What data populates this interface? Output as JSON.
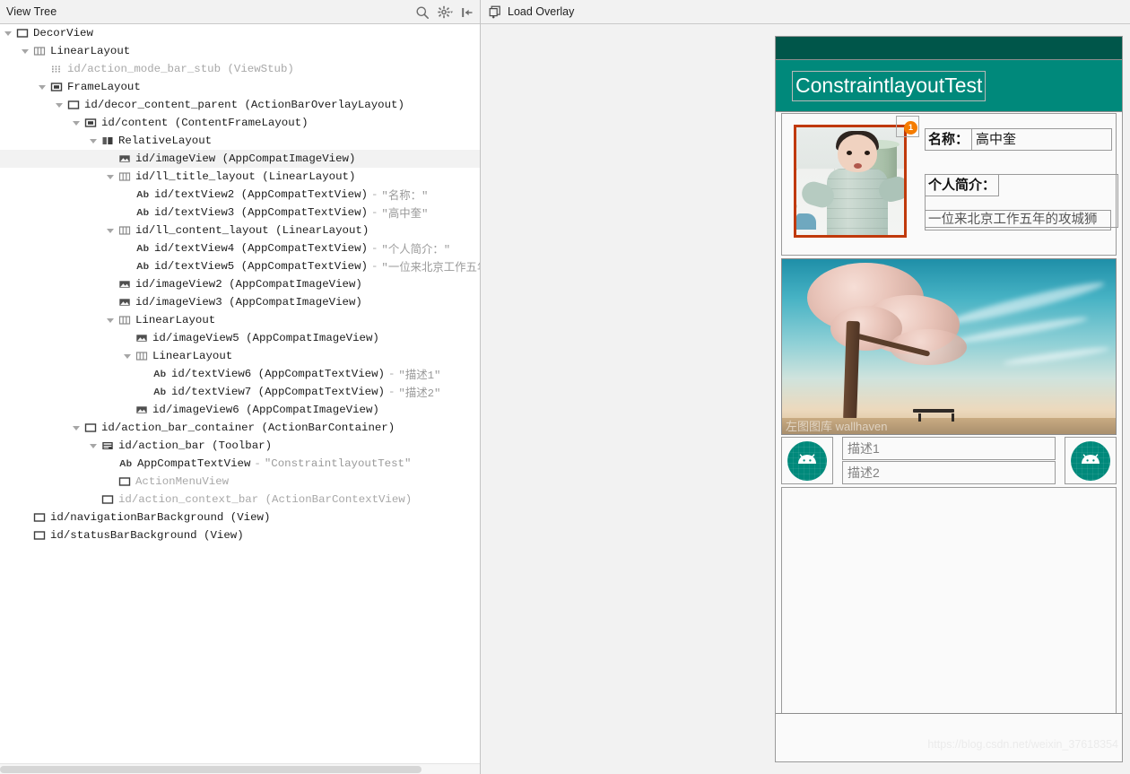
{
  "tree_panel": {
    "title": "View Tree",
    "header_icons": [
      {
        "name": "search-icon",
        "label": "Search"
      },
      {
        "name": "gear-dropdown-icon",
        "label": "Settings"
      },
      {
        "name": "collapse-panel-icon",
        "label": "Collapse"
      }
    ],
    "nodes": [
      {
        "depth": 0,
        "twisty": true,
        "icon": "framelayout-icon",
        "label": "DecorView",
        "type": "",
        "value": "",
        "dim": false,
        "selected": false
      },
      {
        "depth": 1,
        "twisty": true,
        "icon": "linearlayout-icon",
        "label": "LinearLayout",
        "type": "",
        "value": "",
        "dim": false,
        "selected": false
      },
      {
        "depth": 2,
        "twisty": false,
        "icon": "viewstub-icon",
        "label": "id/action_mode_bar_stub",
        "type": "(ViewStub)",
        "value": "",
        "dim": true,
        "selected": false
      },
      {
        "depth": 2,
        "twisty": true,
        "icon": "framelayout-filled-icon",
        "label": "FrameLayout",
        "type": "",
        "value": "",
        "dim": false,
        "selected": false
      },
      {
        "depth": 3,
        "twisty": true,
        "icon": "framelayout-icon",
        "label": "id/decor_content_parent",
        "type": "(ActionBarOverlayLayout)",
        "value": "",
        "dim": false,
        "selected": false
      },
      {
        "depth": 4,
        "twisty": true,
        "icon": "framelayout-filled-icon",
        "label": "id/content",
        "type": "(ContentFrameLayout)",
        "value": "",
        "dim": false,
        "selected": false
      },
      {
        "depth": 5,
        "twisty": true,
        "icon": "relativelayout-icon",
        "label": "RelativeLayout",
        "type": "",
        "value": "",
        "dim": false,
        "selected": false
      },
      {
        "depth": 6,
        "twisty": false,
        "icon": "imageview-icon",
        "label": "id/imageView",
        "type": "(AppCompatImageView)",
        "value": "",
        "dim": false,
        "selected": true
      },
      {
        "depth": 6,
        "twisty": true,
        "icon": "linearlayout-icon",
        "label": "id/ll_title_layout",
        "type": "(LinearLayout)",
        "value": "",
        "dim": false,
        "selected": false
      },
      {
        "depth": 7,
        "twisty": false,
        "icon": "textview-icon",
        "label": "id/textView2",
        "type": "(AppCompatTextView)",
        "value": "\"名称：\"",
        "dim": false,
        "selected": false
      },
      {
        "depth": 7,
        "twisty": false,
        "icon": "textview-icon",
        "label": "id/textView3",
        "type": "(AppCompatTextView)",
        "value": "\"高中奎\"",
        "dim": false,
        "selected": false
      },
      {
        "depth": 6,
        "twisty": true,
        "icon": "linearlayout-icon",
        "label": "id/ll_content_layout",
        "type": "(LinearLayout)",
        "value": "",
        "dim": false,
        "selected": false
      },
      {
        "depth": 7,
        "twisty": false,
        "icon": "textview-icon",
        "label": "id/textView4",
        "type": "(AppCompatTextView)",
        "value": "\"个人简介：\"",
        "dim": false,
        "selected": false
      },
      {
        "depth": 7,
        "twisty": false,
        "icon": "textview-icon",
        "label": "id/textView5",
        "type": "(AppCompatTextView)",
        "value": "\"一位来北京工作五年的攻城狮\"",
        "dim": false,
        "selected": false
      },
      {
        "depth": 6,
        "twisty": false,
        "icon": "imageview-icon",
        "label": "id/imageView2",
        "type": "(AppCompatImageView)",
        "value": "",
        "dim": false,
        "selected": false
      },
      {
        "depth": 6,
        "twisty": false,
        "icon": "imageview-icon",
        "label": "id/imageView3",
        "type": "(AppCompatImageView)",
        "value": "",
        "dim": false,
        "selected": false
      },
      {
        "depth": 6,
        "twisty": true,
        "icon": "linearlayout-icon",
        "label": "LinearLayout",
        "type": "",
        "value": "",
        "dim": false,
        "selected": false
      },
      {
        "depth": 7,
        "twisty": false,
        "icon": "imageview-icon",
        "label": "id/imageView5",
        "type": "(AppCompatImageView)",
        "value": "",
        "dim": false,
        "selected": false
      },
      {
        "depth": 7,
        "twisty": true,
        "icon": "linearlayout-icon",
        "label": "LinearLayout",
        "type": "",
        "value": "",
        "dim": false,
        "selected": false
      },
      {
        "depth": 8,
        "twisty": false,
        "icon": "textview-icon",
        "label": "id/textView6",
        "type": "(AppCompatTextView)",
        "value": "\"描述1\"",
        "dim": false,
        "selected": false
      },
      {
        "depth": 8,
        "twisty": false,
        "icon": "textview-icon",
        "label": "id/textView7",
        "type": "(AppCompatTextView)",
        "value": "\"描述2\"",
        "dim": false,
        "selected": false
      },
      {
        "depth": 7,
        "twisty": false,
        "icon": "imageview-icon",
        "label": "id/imageView6",
        "type": "(AppCompatImageView)",
        "value": "",
        "dim": false,
        "selected": false
      },
      {
        "depth": 4,
        "twisty": true,
        "icon": "framelayout-icon",
        "label": "id/action_bar_container",
        "type": "(ActionBarContainer)",
        "value": "",
        "dim": false,
        "selected": false
      },
      {
        "depth": 5,
        "twisty": true,
        "icon": "toolbar-icon",
        "label": "id/action_bar",
        "type": "(Toolbar)",
        "value": "",
        "dim": false,
        "selected": false
      },
      {
        "depth": 6,
        "twisty": false,
        "icon": "textview-icon",
        "label": "AppCompatTextView",
        "type": "",
        "value": "\"ConstraintlayoutTest\"",
        "dim": false,
        "selected": false
      },
      {
        "depth": 6,
        "twisty": false,
        "icon": "framelayout-icon",
        "label": "ActionMenuView",
        "type": "",
        "value": "",
        "dim": true,
        "selected": false
      },
      {
        "depth": 5,
        "twisty": false,
        "icon": "framelayout-icon",
        "label": "id/action_context_bar",
        "type": "(ActionBarContextView)",
        "value": "",
        "dim": true,
        "selected": false
      },
      {
        "depth": 1,
        "twisty": false,
        "icon": "framelayout-icon",
        "label": "id/navigationBarBackground",
        "type": "(View)",
        "value": "",
        "dim": false,
        "selected": false
      },
      {
        "depth": 1,
        "twisty": false,
        "icon": "framelayout-icon",
        "label": "id/statusBarBackground",
        "type": "(View)",
        "value": "",
        "dim": false,
        "selected": false
      }
    ]
  },
  "overlay_toolbar": {
    "load_overlay_label": "Load Overlay",
    "load_overlay_icon": "load-overlay-icon"
  },
  "device_preview": {
    "app_bar_title": "ConstraintlayoutTest",
    "photo_badge_count": "1",
    "name_label": "名称：",
    "name_value": "高中奎",
    "bio_label": "个人简介：",
    "bio_value": "一位来北京工作五年的攻城狮",
    "desc1": "描述1",
    "desc2": "描述2",
    "scenery_watermark": "左图图库 wallhaven",
    "watermark": "https://blog.csdn.net/weixin_37618354"
  },
  "colors": {
    "status_bar": "#00564a",
    "app_bar": "#00897b",
    "badge": "#f57c00",
    "photo_border": "#c0390b",
    "selection": "#f2f2f2"
  }
}
